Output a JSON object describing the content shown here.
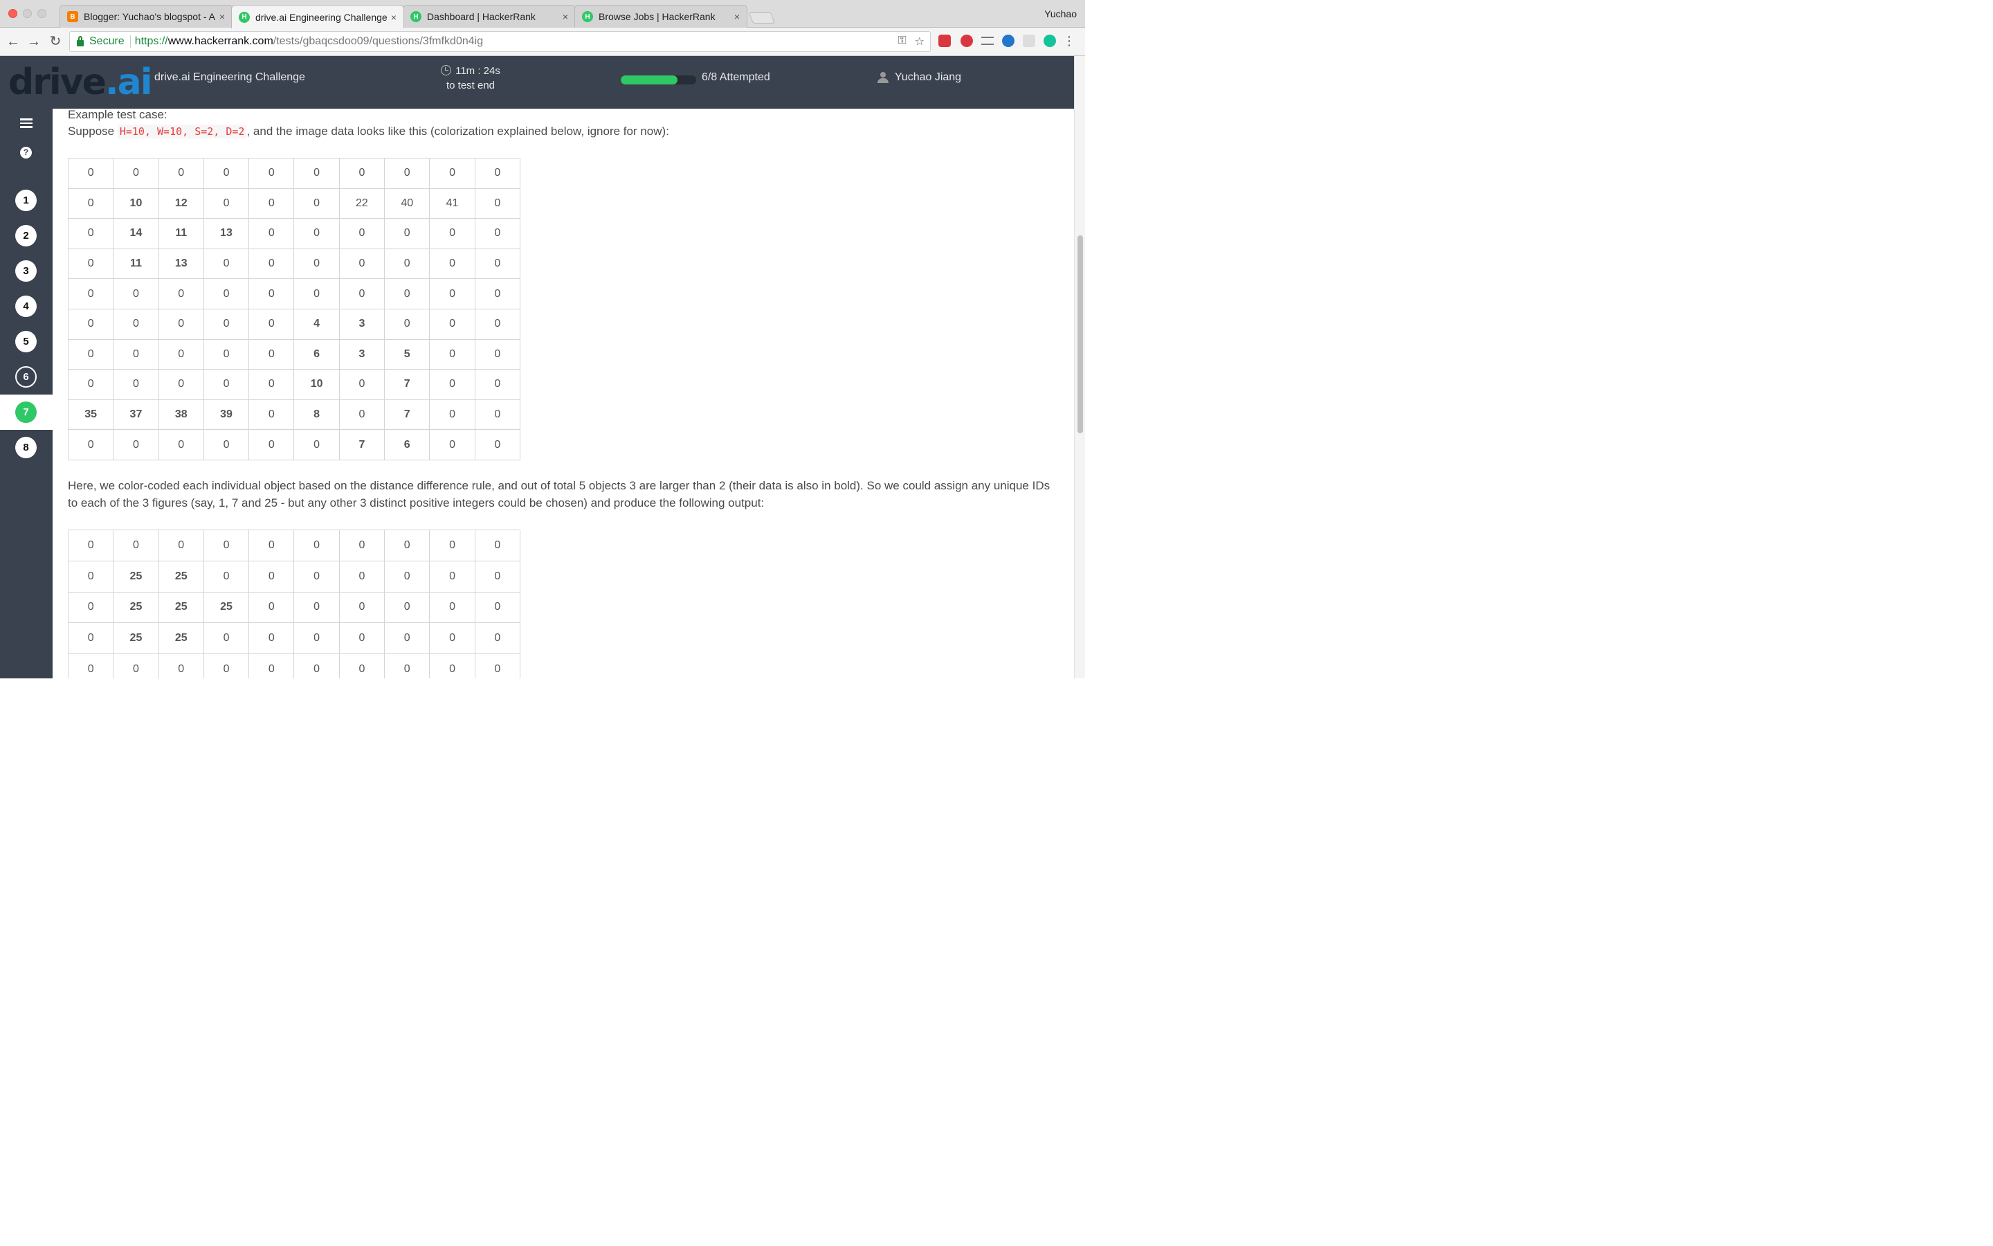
{
  "browser": {
    "profile_name": "Yuchao",
    "tabs": [
      {
        "label": "Blogger: Yuchao's blogspot - A",
        "icon": "blogger-icon",
        "active": false
      },
      {
        "label": "drive.ai Engineering Challenge",
        "icon": "hackerrank-icon",
        "active": true
      },
      {
        "label": "Dashboard | HackerRank",
        "icon": "hackerrank-icon",
        "active": false
      },
      {
        "label": "Browse Jobs | HackerRank",
        "icon": "hackerrank-icon",
        "active": false
      }
    ],
    "close_glyph": "×",
    "secure_label": "Secure",
    "url_scheme": "https://",
    "url_host": "www.hackerrank.com",
    "url_path": "/tests/gbaqcsdoo09/questions/3fmfkd0n4ig"
  },
  "header": {
    "logo_text": "drive",
    "logo_suffix": ".ai",
    "challenge_title": "drive.ai Engineering Challenge",
    "timer_value": "11m : 24s",
    "timer_caption": "to test end",
    "progress_fraction": 0.75,
    "attempted_text": "6/8 Attempted",
    "user_name": "Yuchao Jiang"
  },
  "sidebar": {
    "help_glyph": "?",
    "questions": [
      "1",
      "2",
      "3",
      "4",
      "5",
      "6",
      "7",
      "8"
    ],
    "current_question": "7"
  },
  "content": {
    "example_heading": "Example test case:",
    "suppose_prefix": "Suppose ",
    "suppose_params": "H=10, W=10, S=2, D=2",
    "suppose_suffix": ", and the image data looks like this (colorization explained below, ignore for now):",
    "grid1": [
      [
        [
          "0",
          ""
        ],
        [
          "0",
          ""
        ],
        [
          "0",
          ""
        ],
        [
          "0",
          ""
        ],
        [
          "0",
          ""
        ],
        [
          "0",
          ""
        ],
        [
          "0",
          ""
        ],
        [
          "0",
          ""
        ],
        [
          "0",
          ""
        ],
        [
          "0",
          ""
        ]
      ],
      [
        [
          "0",
          ""
        ],
        [
          "10",
          "r"
        ],
        [
          "12",
          "r"
        ],
        [
          "0",
          ""
        ],
        [
          "0",
          ""
        ],
        [
          "0",
          ""
        ],
        [
          "22",
          "p"
        ],
        [
          "40",
          "o"
        ],
        [
          "41",
          "o"
        ],
        [
          "0",
          ""
        ]
      ],
      [
        [
          "0",
          ""
        ],
        [
          "14",
          "r"
        ],
        [
          "11",
          "r"
        ],
        [
          "13",
          "r"
        ],
        [
          "0",
          ""
        ],
        [
          "0",
          ""
        ],
        [
          "0",
          ""
        ],
        [
          "0",
          ""
        ],
        [
          "0",
          ""
        ],
        [
          "0",
          ""
        ]
      ],
      [
        [
          "0",
          ""
        ],
        [
          "11",
          "r"
        ],
        [
          "13",
          "r"
        ],
        [
          "0",
          ""
        ],
        [
          "0",
          ""
        ],
        [
          "0",
          ""
        ],
        [
          "0",
          ""
        ],
        [
          "0",
          ""
        ],
        [
          "0",
          ""
        ],
        [
          "0",
          ""
        ]
      ],
      [
        [
          "0",
          ""
        ],
        [
          "0",
          ""
        ],
        [
          "0",
          ""
        ],
        [
          "0",
          ""
        ],
        [
          "0",
          ""
        ],
        [
          "0",
          ""
        ],
        [
          "0",
          ""
        ],
        [
          "0",
          ""
        ],
        [
          "0",
          ""
        ],
        [
          "0",
          ""
        ]
      ],
      [
        [
          "0",
          ""
        ],
        [
          "0",
          ""
        ],
        [
          "0",
          ""
        ],
        [
          "0",
          ""
        ],
        [
          "0",
          ""
        ],
        [
          "4",
          "g"
        ],
        [
          "3",
          "g"
        ],
        [
          "0",
          ""
        ],
        [
          "0",
          ""
        ],
        [
          "0",
          ""
        ]
      ],
      [
        [
          "0",
          ""
        ],
        [
          "0",
          ""
        ],
        [
          "0",
          ""
        ],
        [
          "0",
          ""
        ],
        [
          "0",
          ""
        ],
        [
          "6",
          "g"
        ],
        [
          "3",
          "g"
        ],
        [
          "5",
          "g"
        ],
        [
          "0",
          ""
        ],
        [
          "0",
          ""
        ]
      ],
      [
        [
          "0",
          ""
        ],
        [
          "0",
          ""
        ],
        [
          "0",
          ""
        ],
        [
          "0",
          ""
        ],
        [
          "0",
          ""
        ],
        [
          "10",
          "g"
        ],
        [
          "0",
          ""
        ],
        [
          "7",
          "g"
        ],
        [
          "0",
          ""
        ],
        [
          "0",
          ""
        ]
      ],
      [
        [
          "35",
          "b"
        ],
        [
          "37",
          "b"
        ],
        [
          "38",
          "b"
        ],
        [
          "39",
          "b"
        ],
        [
          "0",
          ""
        ],
        [
          "8",
          "g"
        ],
        [
          "0",
          ""
        ],
        [
          "7",
          "g"
        ],
        [
          "0",
          ""
        ],
        [
          "0",
          ""
        ]
      ],
      [
        [
          "0",
          ""
        ],
        [
          "0",
          ""
        ],
        [
          "0",
          ""
        ],
        [
          "0",
          ""
        ],
        [
          "0",
          ""
        ],
        [
          "0",
          ""
        ],
        [
          "7",
          "g"
        ],
        [
          "6",
          "g"
        ],
        [
          "0",
          ""
        ],
        [
          "0",
          ""
        ]
      ]
    ],
    "explanation": "Here, we color-coded each individual object based on the distance difference rule, and out of total 5 objects 3 are larger than 2 (their data is also in bold). So we could assign any unique IDs to each of the 3 figures (say, 1, 7 and 25 - but any other 3 distinct positive integers could be chosen) and produce the following output:",
    "grid2": [
      [
        [
          "0",
          ""
        ],
        [
          "0",
          ""
        ],
        [
          "0",
          ""
        ],
        [
          "0",
          ""
        ],
        [
          "0",
          ""
        ],
        [
          "0",
          ""
        ],
        [
          "0",
          ""
        ],
        [
          "0",
          ""
        ],
        [
          "0",
          ""
        ],
        [
          "0",
          ""
        ]
      ],
      [
        [
          "0",
          ""
        ],
        [
          "25",
          "r"
        ],
        [
          "25",
          "r"
        ],
        [
          "0",
          ""
        ],
        [
          "0",
          ""
        ],
        [
          "0",
          ""
        ],
        [
          "0",
          ""
        ],
        [
          "0",
          ""
        ],
        [
          "0",
          ""
        ],
        [
          "0",
          ""
        ]
      ],
      [
        [
          "0",
          ""
        ],
        [
          "25",
          "r"
        ],
        [
          "25",
          "r"
        ],
        [
          "25",
          "r"
        ],
        [
          "0",
          ""
        ],
        [
          "0",
          ""
        ],
        [
          "0",
          ""
        ],
        [
          "0",
          ""
        ],
        [
          "0",
          ""
        ],
        [
          "0",
          ""
        ]
      ],
      [
        [
          "0",
          ""
        ],
        [
          "25",
          "r"
        ],
        [
          "25",
          "r"
        ],
        [
          "0",
          ""
        ],
        [
          "0",
          ""
        ],
        [
          "0",
          ""
        ],
        [
          "0",
          ""
        ],
        [
          "0",
          ""
        ],
        [
          "0",
          ""
        ],
        [
          "0",
          ""
        ]
      ],
      [
        [
          "0",
          ""
        ],
        [
          "0",
          ""
        ],
        [
          "0",
          ""
        ],
        [
          "0",
          ""
        ],
        [
          "0",
          ""
        ],
        [
          "0",
          ""
        ],
        [
          "0",
          ""
        ],
        [
          "0",
          ""
        ],
        [
          "0",
          ""
        ],
        [
          "0",
          ""
        ]
      ]
    ]
  },
  "colors": {
    "header_bg": "#39424e",
    "accent_green": "#2ec866",
    "red": "#e31a1c",
    "blue": "#1414b4",
    "green": "#1a8a1a",
    "purple": "#8a1a8a",
    "orange": "#e8761a"
  }
}
